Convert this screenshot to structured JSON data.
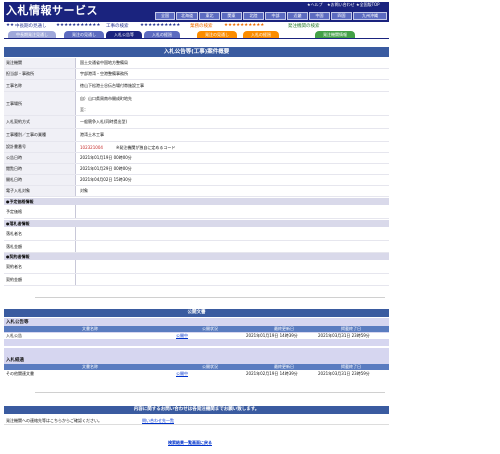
{
  "header": {
    "logo": "入札情報サービス",
    "top_links": [
      "★ヘルプ",
      "★お問い合わせ",
      "★全国版TOP"
    ],
    "regions": [
      "全国",
      "北海道",
      "東北",
      "関東",
      "北陸",
      "中部",
      "近畿",
      "中国",
      "四国",
      "九州沖縄"
    ]
  },
  "categories": {
    "c1": "中長期の見通し",
    "c2": "工事の検索",
    "c3": "業務の検索",
    "c4": "発注機関の検索",
    "stars_left": "★★",
    "stars_mid": "★★★★★★★★★★★",
    "stars_right": "★★★★★★★★★★"
  },
  "tabs": [
    {
      "label": "中長期発注見通し",
      "color": "#9fa8da"
    },
    {
      "label": "発注の見通し",
      "color": "#5c6bc0"
    },
    {
      "label": "入札公告等",
      "color": "#1a237e"
    },
    {
      "label": "入札の経過",
      "color": "#5c6bc0"
    },
    {
      "label": "発注の見通し",
      "color": "#fb8c00"
    },
    {
      "label": "入札の経過",
      "color": "#fb8c00"
    },
    {
      "label": "発注機関情報",
      "color": "#43a047"
    }
  ],
  "main": {
    "title": "入札公告等(工事)案件概要",
    "rows": [
      {
        "label": "発注機関",
        "value": "国土交通省中国地方整備局"
      },
      {
        "label": "担当部・事務所",
        "value": "宇部港湾・空港整備事務所"
      },
      {
        "label": "工事名称",
        "value": "徳山下松港士谷伝台場付帯施設工事"
      },
      {
        "label": "工事場所",
        "value": "自）山口県周南市開成町地先",
        "value2": "至："
      },
      {
        "label": "入札契約方式",
        "value": "一般競争入札(同時提出型)"
      },
      {
        "label": "工事種別／工事の業種",
        "value": "港湾土木工事"
      },
      {
        "label": "設計書番号",
        "value": "102321004",
        "value_extra": "※発注機関が独自に定めるコード"
      },
      {
        "label": "公告日時",
        "value": "2021年01月19日 00時00分"
      },
      {
        "label": "閲覧日時",
        "value": "2021年01月29日 00時00分"
      },
      {
        "label": "開札日時",
        "value": "2021年04月02日 15時30分"
      },
      {
        "label": "電子入札対象",
        "value": "対象"
      }
    ],
    "sect_price": "●予定価格情報",
    "price_label": "予定価格",
    "sect_winner": "●落札者情報",
    "winner_rows": [
      "落札者名",
      "落札金額"
    ],
    "sect_contract": "●契約者情報",
    "contract_rows": [
      "契約者名",
      "契約金額"
    ]
  },
  "docs": {
    "title": "公開文書",
    "groups": [
      {
        "heading": "入札公告等",
        "columns": [
          "文書名称",
          "公開状況",
          "最終更新日",
          "掲載終了日"
        ],
        "rows": [
          {
            "name": "入札公告",
            "status": "公開中",
            "updated": "2021年01月19日 14時39分",
            "ends": "2021年03月31日 23時59分"
          }
        ]
      },
      {
        "heading": "入札経過",
        "columns": [
          "文書名称",
          "公開状況",
          "最終更新日",
          "掲載終了日"
        ],
        "rows": [
          {
            "name": "その他関連文書",
            "status": "公開中",
            "updated": "2021年02月19日 14時39分",
            "ends": "2021年03月31日 23時59分"
          }
        ]
      }
    ]
  },
  "inquiry": {
    "title": "内容に関するお問い合わせは各発注機関までお願い致します。",
    "label": "発注機関への連絡先等はこちらからご確認ください。",
    "link": "問い合わせ先一覧"
  },
  "back_link": "検索結果一覧画面に戻る"
}
